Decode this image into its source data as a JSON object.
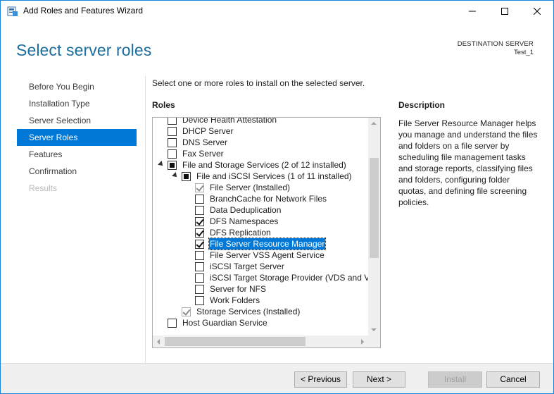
{
  "window": {
    "title": "Add Roles and Features Wizard",
    "border_color": "#1883d7"
  },
  "header": {
    "page_title": "Select server roles",
    "destination_label": "DESTINATION SERVER",
    "destination_value": "Test_1"
  },
  "nav": {
    "items": [
      {
        "label": "Before You Begin",
        "state": "normal"
      },
      {
        "label": "Installation Type",
        "state": "normal"
      },
      {
        "label": "Server Selection",
        "state": "normal"
      },
      {
        "label": "Server Roles",
        "state": "active"
      },
      {
        "label": "Features",
        "state": "normal"
      },
      {
        "label": "Confirmation",
        "state": "normal"
      },
      {
        "label": "Results",
        "state": "disabled"
      }
    ],
    "active_color": "#0078d7"
  },
  "content": {
    "instruction": "Select one or more roles to install on the selected server.",
    "roles_label": "Roles",
    "description_label": "Description",
    "description_text": "File Server Resource Manager helps you manage and understand the files and folders on a file server by scheduling file management tasks and storage reports, classifying files and folders, configuring folder quotas, and defining file screening policies."
  },
  "roles": [
    {
      "label": "Device Health Attestation",
      "level": 0,
      "check": "unchecked"
    },
    {
      "label": "DHCP Server",
      "level": 0,
      "check": "unchecked"
    },
    {
      "label": "DNS Server",
      "level": 0,
      "check": "unchecked"
    },
    {
      "label": "Fax Server",
      "level": 0,
      "check": "unchecked"
    },
    {
      "label": "File and Storage Services (2 of 12 installed)",
      "level": 0,
      "check": "partial",
      "expanded": true
    },
    {
      "label": "File and iSCSI Services (1 of 11 installed)",
      "level": 1,
      "check": "partial",
      "expanded": true
    },
    {
      "label": "File Server (Installed)",
      "level": 2,
      "check": "checked-grey"
    },
    {
      "label": "BranchCache for Network Files",
      "level": 2,
      "check": "unchecked"
    },
    {
      "label": "Data Deduplication",
      "level": 2,
      "check": "unchecked"
    },
    {
      "label": "DFS Namespaces",
      "level": 2,
      "check": "checked"
    },
    {
      "label": "DFS Replication",
      "level": 2,
      "check": "checked"
    },
    {
      "label": "File Server Resource Manager",
      "level": 2,
      "check": "checked",
      "selected": true
    },
    {
      "label": "File Server VSS Agent Service",
      "level": 2,
      "check": "unchecked"
    },
    {
      "label": "iSCSI Target Server",
      "level": 2,
      "check": "unchecked"
    },
    {
      "label": "iSCSI Target Storage Provider (VDS and VSS",
      "level": 2,
      "check": "unchecked"
    },
    {
      "label": "Server for NFS",
      "level": 2,
      "check": "unchecked"
    },
    {
      "label": "Work Folders",
      "level": 2,
      "check": "unchecked"
    },
    {
      "label": "Storage Services (Installed)",
      "level": 1,
      "check": "checked-grey"
    },
    {
      "label": "Host Guardian Service",
      "level": 0,
      "check": "unchecked"
    }
  ],
  "footer": {
    "previous_label": "< Previous",
    "next_label": "Next >",
    "install_label": "Install",
    "cancel_label": "Cancel"
  }
}
